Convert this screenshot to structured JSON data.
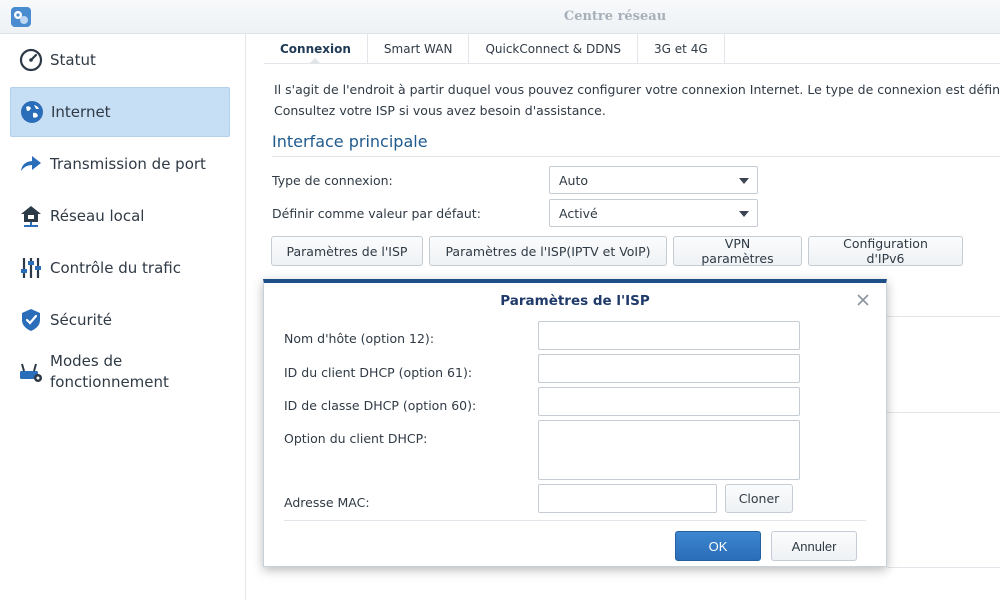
{
  "window": {
    "title": "Centre réseau"
  },
  "sidebar": {
    "items": [
      {
        "label": "Statut"
      },
      {
        "label": "Internet"
      },
      {
        "label": "Transmission de port"
      },
      {
        "label": "Réseau local"
      },
      {
        "label": "Contrôle du trafic"
      },
      {
        "label": "Sécurité"
      },
      {
        "label_line1": "Modes de",
        "label_line2": "fonctionnement"
      }
    ]
  },
  "tabs": [
    {
      "label": "Connexion"
    },
    {
      "label": "Smart WAN"
    },
    {
      "label": "QuickConnect & DDNS"
    },
    {
      "label": "3G et 4G"
    }
  ],
  "main": {
    "desc_line1": "Il s'agit de l'endroit à partir duquel vous pouvez configurer votre connexion Internet. Le type de connexion est défini p",
    "desc_line2": "Consultez votre ISP si vous avez besoin d'assistance.",
    "section_title": "Interface principale",
    "connection_type_label": "Type de connexion:",
    "connection_type_value": "Auto",
    "default_label": "Définir comme valeur par défaut:",
    "default_value": "Activé",
    "buttons": {
      "isp": "Paramètres de l'ISP",
      "isp_iptv": "Paramètres de l'ISP(IPTV et VoIP)",
      "vpn": "VPN paramètres",
      "ipv6": "Configuration d'IPv6"
    }
  },
  "dialog": {
    "title": "Paramètres de l'ISP",
    "hostname_label": "Nom d'hôte (option 12):",
    "hostname_value": "",
    "dhcp_client_id_label": "ID du client DHCP (option 61):",
    "dhcp_client_id_value": "",
    "dhcp_class_id_label": "ID de classe DHCP (option 60):",
    "dhcp_class_id_value": "",
    "dhcp_option_label": "Option du client DHCP:",
    "dhcp_option_value": "",
    "mac_label": "Adresse MAC:",
    "mac_value": "",
    "clone_label": "Cloner",
    "ok_label": "OK",
    "cancel_label": "Annuler"
  },
  "colors": {
    "accent": "#1e4f86",
    "active_nav_bg": "#c7dff5",
    "primary_button": "#2a6db8",
    "section_title": "#1f5a8e"
  }
}
